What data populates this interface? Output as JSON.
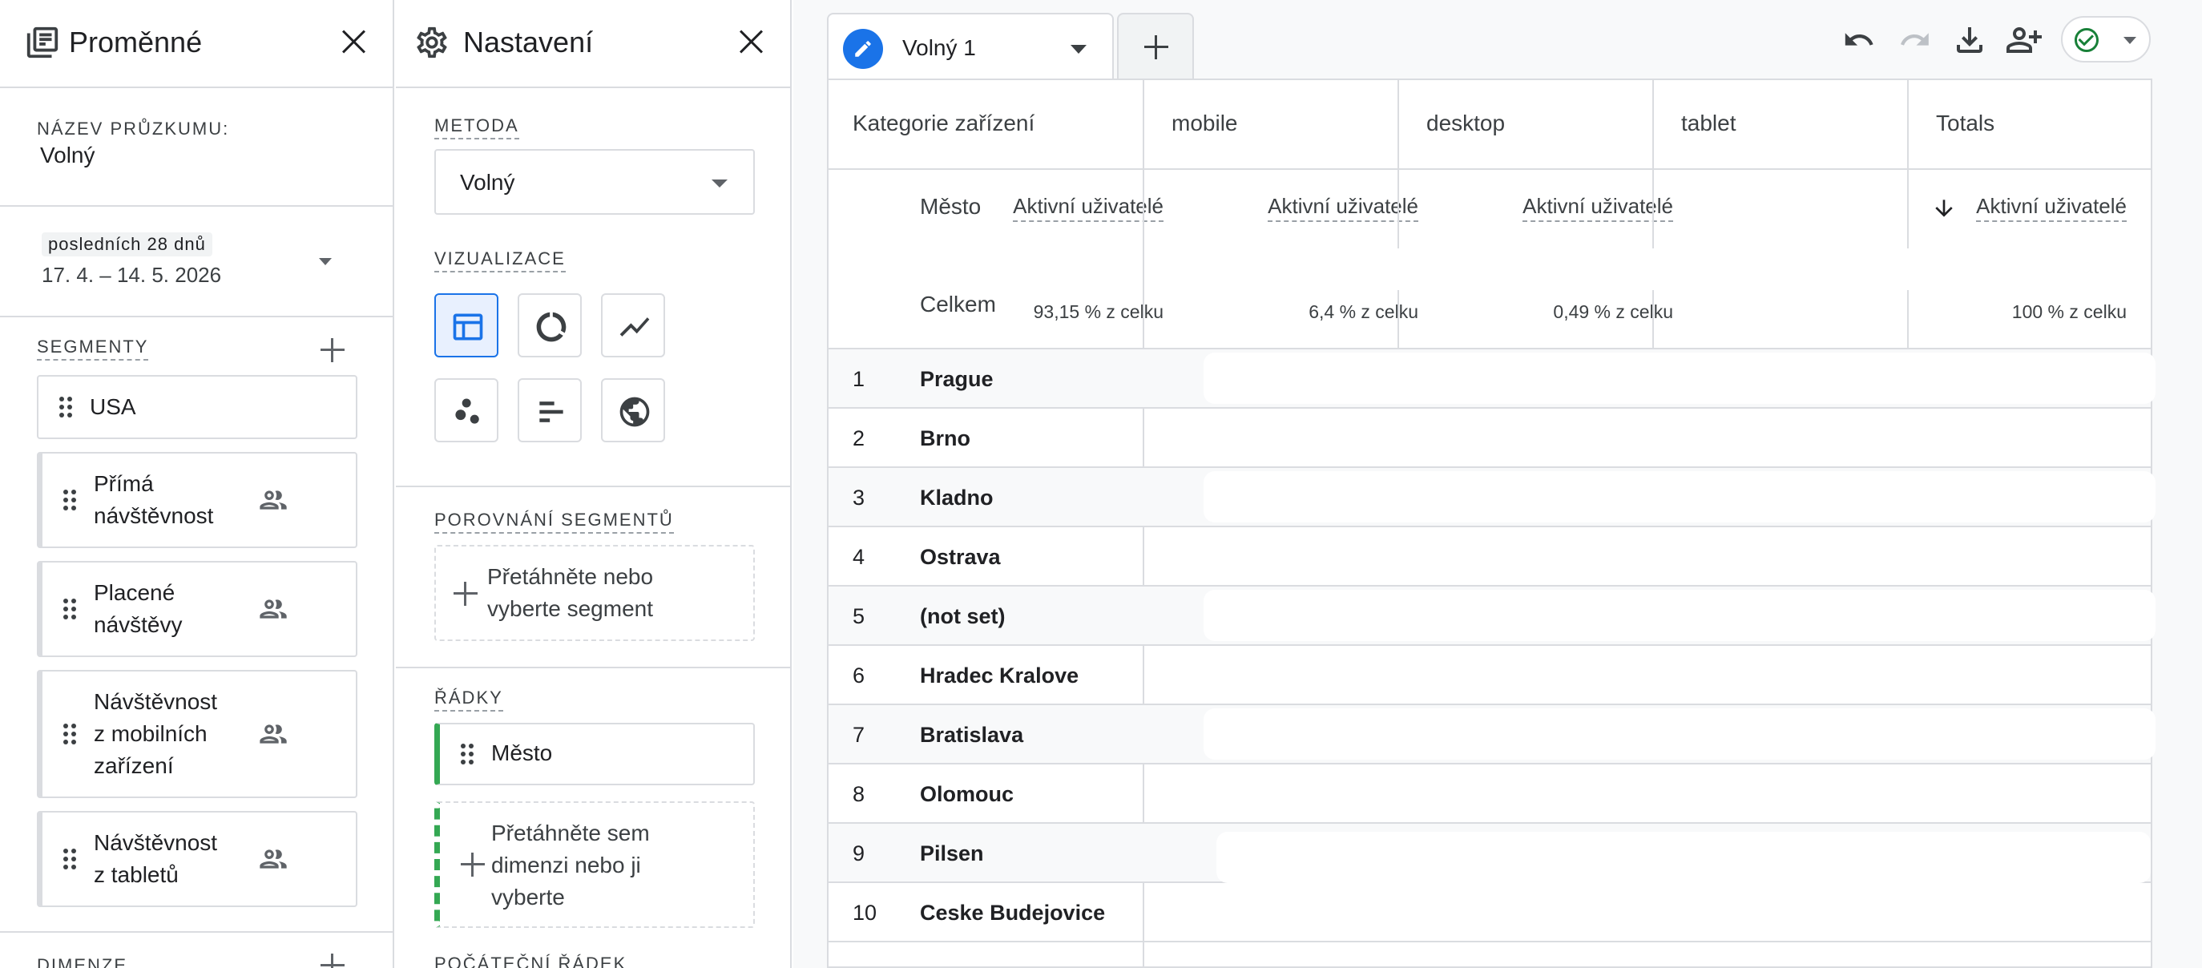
{
  "variables": {
    "title": "Proměnné",
    "name_caption": "NÁZEV PRŮZKUMU:",
    "name_value": "Volný",
    "date_label": "posledních 28 dnů",
    "date_range": "17. 4. – 14. 5. 2026",
    "segments_caption": "SEGMENTY",
    "segments": [
      {
        "label": "USA"
      },
      {
        "label": "Přímá návštěvnost",
        "line1": "Přímá",
        "line2": "návštěvnost"
      },
      {
        "label": "Placené návštěvy",
        "line1": "Placené",
        "line2": "návštěvy"
      },
      {
        "label": "Návštěvnost z mobilních zařízení",
        "line1": "Návštěvnost",
        "line2": "z mobilních",
        "line3": "zařízení"
      },
      {
        "label": "Návštěvnost z tabletů",
        "line1": "Návštěvnost",
        "line2": "z tabletů"
      }
    ],
    "dimensions_caption": "DIMENZE"
  },
  "settings": {
    "title": "Nastavení",
    "method_caption": "METODA",
    "method_value": "Volný",
    "viz_caption": "VIZUALIZACE",
    "comparison_caption": "POROVNÁNÍ SEGMENTŮ",
    "comparison_drop_line1": "Přetáhněte nebo",
    "comparison_drop_line2": "vyberte segment",
    "rows_caption": "ŘÁDKY",
    "row_dimension": "Město",
    "rows_drop_line1": "Přetáhněte sem",
    "rows_drop_line2": "dimenzi nebo ji",
    "rows_drop_line3": "vyberte",
    "start_row_caption": "POČÁTEČNÍ ŘÁDEK"
  },
  "tab": {
    "label": "Volný 1"
  },
  "table": {
    "pivot_header": "Kategorie zařízení",
    "row_dimension": "Město",
    "columns": [
      "mobile",
      "desktop",
      "tablet",
      "Totals"
    ],
    "metric": "Aktivní uživatelé",
    "total_label": "Celkem",
    "totals_pct": [
      "93,15 % z celku",
      "6,4 % z celku",
      "0,49 % z celku",
      "100 % z celku"
    ],
    "rows": [
      {
        "n": "1",
        "city": "Prague"
      },
      {
        "n": "2",
        "city": "Brno"
      },
      {
        "n": "3",
        "city": "Kladno"
      },
      {
        "n": "4",
        "city": "Ostrava"
      },
      {
        "n": "5",
        "city": "(not set)"
      },
      {
        "n": "6",
        "city": "Hradec Kralove"
      },
      {
        "n": "7",
        "city": "Bratislava"
      },
      {
        "n": "8",
        "city": "Olomouc"
      },
      {
        "n": "9",
        "city": "Pilsen"
      },
      {
        "n": "10",
        "city": "Ceske Budejovice"
      }
    ]
  },
  "colors": {
    "accent": "#1a73e8",
    "success": "#188038",
    "row_accent": "#34a853",
    "border": "#dadce0"
  }
}
